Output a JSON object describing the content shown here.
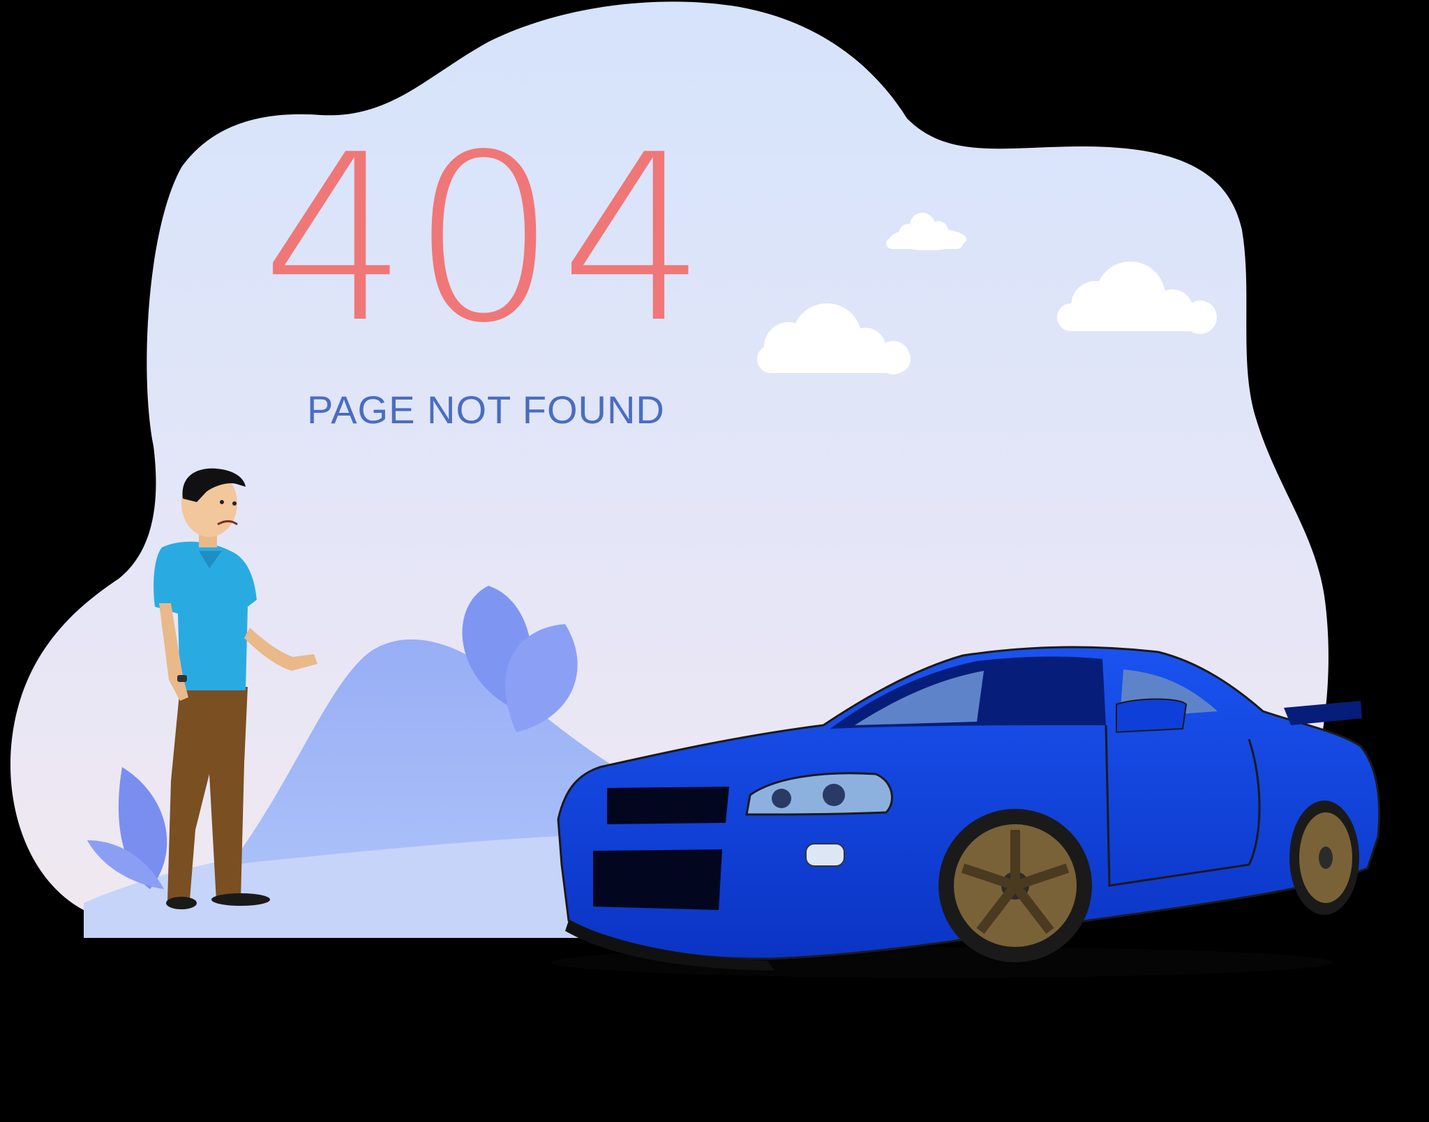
{
  "error": {
    "code": "404",
    "message": "PAGE NOT FOUND"
  },
  "scene": {
    "illustration": "404-car-illustration",
    "elements": [
      "cloud-blob-icon",
      "cloud-icon",
      "hill-icon",
      "leaf-icon",
      "man-figure-icon",
      "sports-car-icon"
    ]
  },
  "colors": {
    "page_background": "#000000",
    "blob_top": "#D6E4FB",
    "blob_bottom": "#EEE6F2",
    "error_code": "#F07777",
    "error_message": "#4A6DC1",
    "car_body": "#0E3FD8",
    "car_dark": "#061E7A",
    "hill": "#9BB2F7",
    "leaf": "#7D8FF0",
    "cloud": "#FFFFFF",
    "shirt": "#29ABE2",
    "pants": "#7A4F22",
    "wheel": "#7A6238"
  }
}
